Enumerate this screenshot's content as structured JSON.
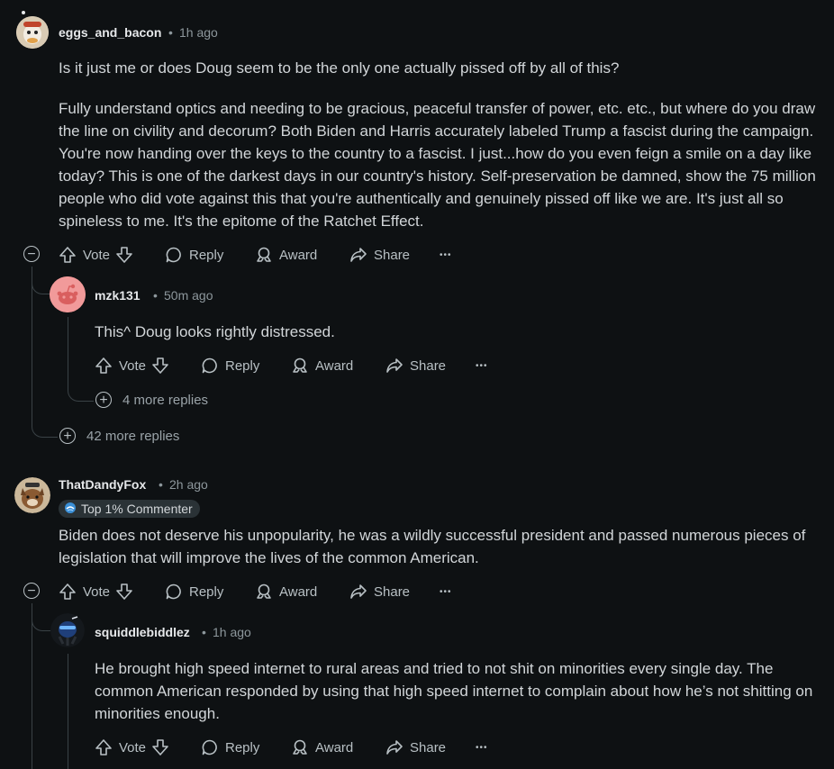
{
  "comments": [
    {
      "username": "eggs_and_bacon",
      "time": "1h ago",
      "paragraphs": [
        "Is it just me or does Doug seem to be the only one actually pissed off by all of this?",
        "Fully understand optics and needing to be gracious, peaceful transfer of power, etc. etc., but where do you draw the line on civility and decorum? Both Biden and Harris accurately labeled Trump a fascist during the campaign. You're now handing over the keys to the country to a fascist. I just...how do you even feign a smile on a day like today? This is one of the darkest days in our country's history. Self-preservation be damned, show the 75 million people who did vote against this that you're authentically and genuinely pissed off like we are. It's just all so spineless to me. It's the epitome of the Ratchet Effect."
      ],
      "more_replies": "42 more replies",
      "reply": {
        "username": "mzk131",
        "time": "50m ago",
        "text": "This^ Doug looks rightly distressed.",
        "more_replies": "4 more replies"
      }
    },
    {
      "username": "ThatDandyFox",
      "time": "2h ago",
      "badge": "Top 1% Commenter",
      "text": "Biden does not deserve his unpopularity, he was a wildly successful president and passed numerous pieces of legislation that will improve the lives of the common American.",
      "reply": {
        "username": "squiddlebiddlez",
        "time": "1h ago",
        "text": "He brought high speed internet to rural areas and tried to not shit on minorities every single day. The common American responded by using that high speed internet to complain about how he’s not shitting on minorities enough."
      }
    }
  ],
  "actions": {
    "vote": "Vote",
    "reply": "Reply",
    "award": "Award",
    "share": "Share",
    "more": "•••",
    "collapse": "−",
    "expand": "+"
  },
  "separator": "•",
  "icons": [
    "upvote-icon",
    "downvote-icon",
    "reply-bubble-icon",
    "award-icon",
    "share-icon",
    "overflow-icon",
    "collapse-icon",
    "expand-icon",
    "badge-icon"
  ]
}
